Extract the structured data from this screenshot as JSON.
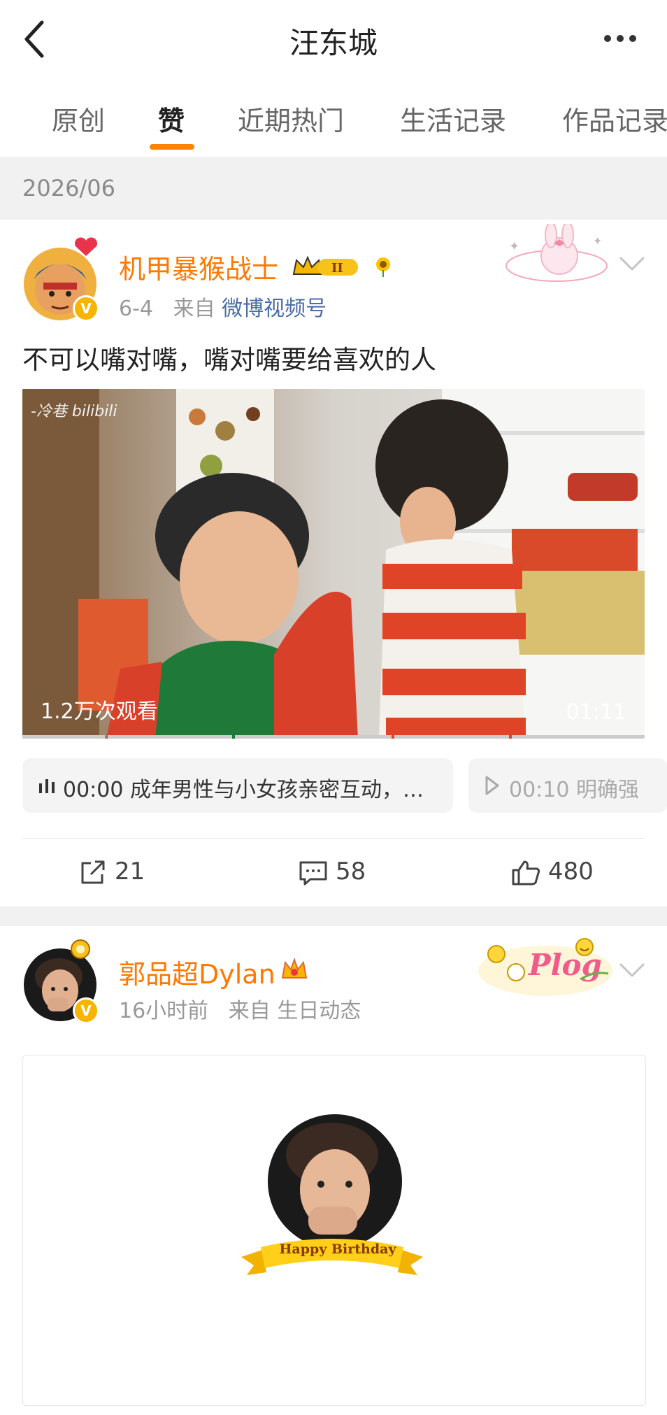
{
  "header": {
    "title": "汪东城"
  },
  "tabs": [
    "原创",
    "赞",
    "近期热门",
    "生活记录",
    "作品记录"
  ],
  "date_header": "2026/06",
  "post1": {
    "author": "机甲暴猴战士",
    "time": "6-4",
    "from_label": "来自",
    "source": "微博视频号",
    "text": "不可以嘴对嘴，嘴对嘴要给喜欢的人",
    "video": {
      "watermark": "-冷巷 bilibili",
      "views": "1.2万次观看",
      "duration": "01:11"
    },
    "chapters": [
      {
        "time": "00:00",
        "text": "成年男性与小女孩亲密互动，…"
      },
      {
        "time": "00:10",
        "text": "明确强"
      }
    ],
    "actions": {
      "share": "21",
      "comment": "58",
      "like": "480"
    },
    "accent": "#ff7800"
  },
  "post2": {
    "author": "郭品超Dylan",
    "time": "16小时前",
    "from_label": "来自",
    "source": "生日动态",
    "card_banner": "Happy Birthday"
  },
  "colors": {
    "accent": "#ff8200",
    "link": "#4a6da8",
    "verified": "#f7b500"
  }
}
